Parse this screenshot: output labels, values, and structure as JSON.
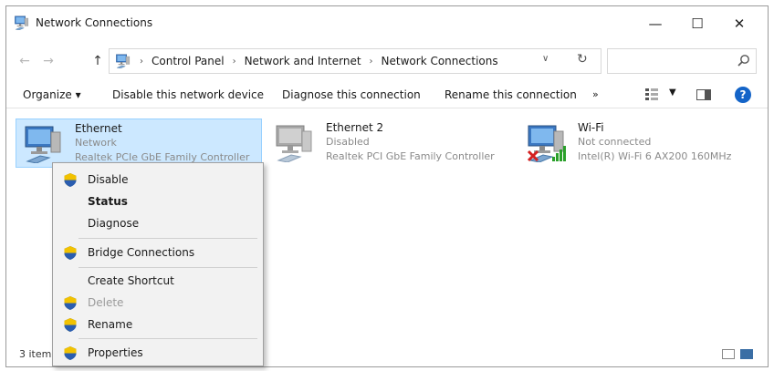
{
  "window": {
    "title": "Network Connections",
    "controls": {
      "minimize": "—",
      "maximize": "☐",
      "close": "✕"
    }
  },
  "address": {
    "crumbs": [
      "Control Panel",
      "Network and Internet",
      "Network Connections"
    ],
    "search_placeholder": ""
  },
  "commands": {
    "organize": "Organize ▾",
    "disable": "Disable this network device",
    "diagnose": "Diagnose this connection",
    "rename": "Rename this connection",
    "more": "»",
    "help": "?"
  },
  "items": [
    {
      "name": "Ethernet",
      "status": "Network",
      "device": "Realtek PCIe GbE Family Controller",
      "selected": true,
      "icon": "ethernet-adapter-icon"
    },
    {
      "name": "Ethernet 2",
      "status": "Disabled",
      "device": "Realtek PCI GbE Family Controller",
      "selected": false,
      "icon": "ethernet-adapter-disabled-icon"
    },
    {
      "name": "Wi-Fi",
      "status": "Not connected",
      "device": "Intel(R) Wi-Fi 6 AX200 160MHz",
      "selected": false,
      "icon": "wifi-adapter-icon"
    }
  ],
  "status_bar": {
    "count": "3 item"
  },
  "context_menu": {
    "items": [
      {
        "label": "Disable",
        "shield": true,
        "bold": false,
        "disabled": false
      },
      {
        "label": "Status",
        "shield": false,
        "bold": true,
        "disabled": false
      },
      {
        "label": "Diagnose",
        "shield": false,
        "bold": false,
        "disabled": false
      },
      {
        "label": "Bridge Connections",
        "shield": true,
        "bold": false,
        "disabled": false
      },
      {
        "label": "Create Shortcut",
        "shield": false,
        "bold": false,
        "disabled": false
      },
      {
        "label": "Delete",
        "shield": true,
        "bold": false,
        "disabled": true
      },
      {
        "label": "Rename",
        "shield": true,
        "bold": false,
        "disabled": false
      },
      {
        "label": "Properties",
        "shield": true,
        "bold": false,
        "disabled": false
      }
    ]
  },
  "colors": {
    "selection": "#cce8ff",
    "selection_border": "#99d1ff",
    "accent": "#1464c8"
  }
}
